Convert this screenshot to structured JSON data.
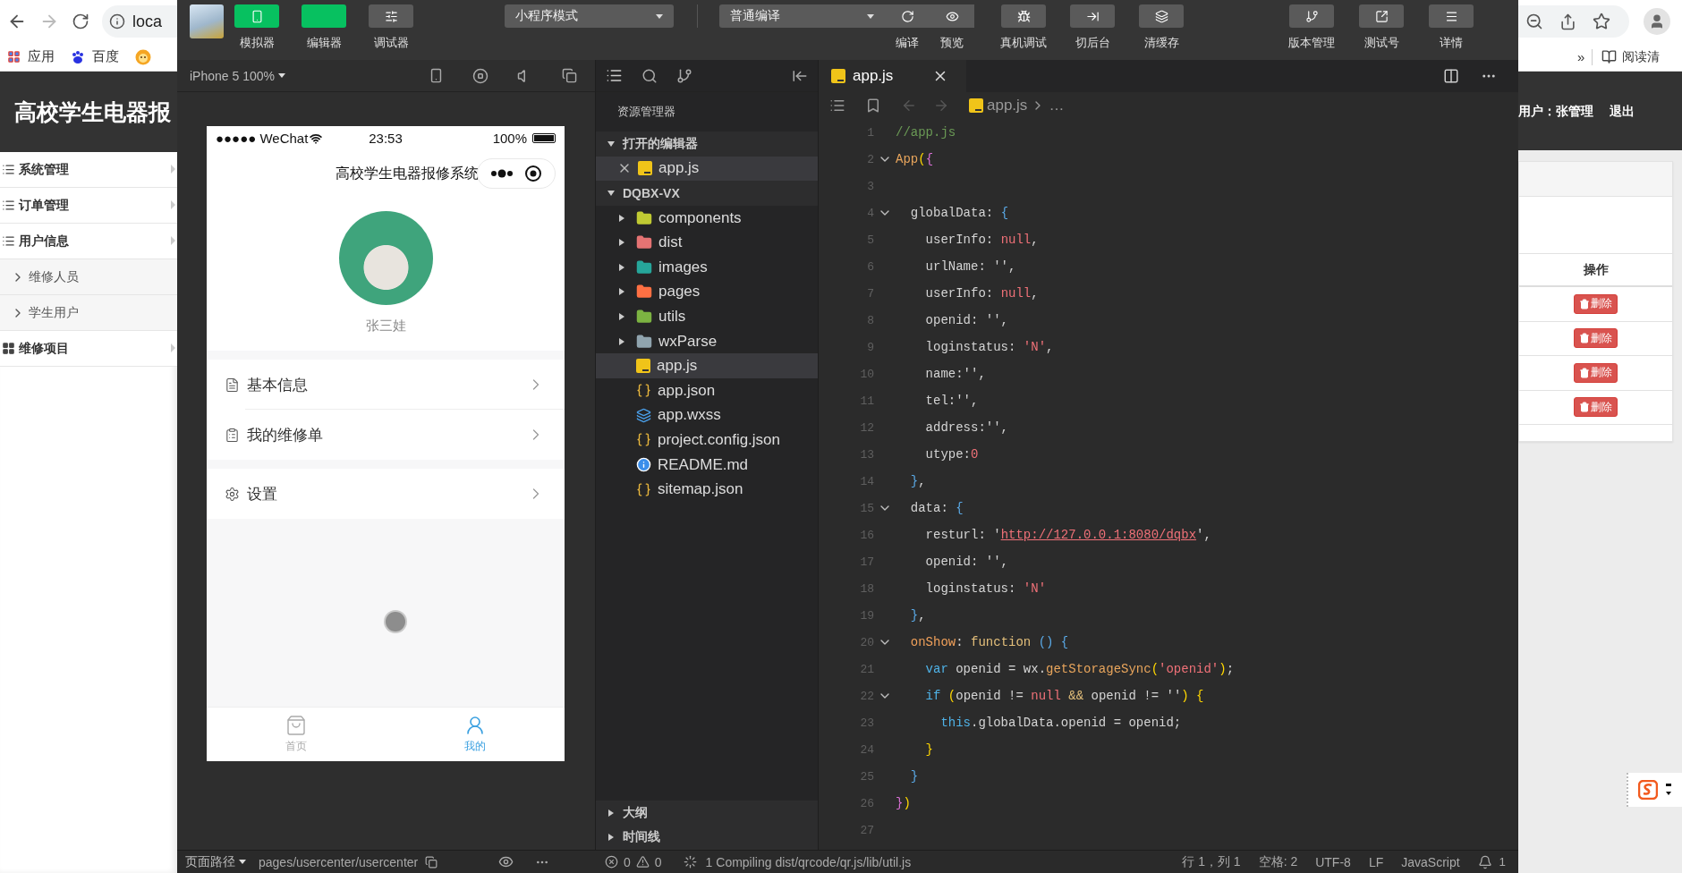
{
  "browser": {
    "address": "loca",
    "bookmarks": [
      {
        "label": "应用",
        "kind": "apps"
      },
      {
        "label": "百度",
        "kind": "baidu"
      },
      {
        "kind": "lion"
      }
    ],
    "more": "»",
    "reading_list": "阅读清"
  },
  "site": {
    "title": "高校学生电器报",
    "user": "用户：张管理",
    "logout": "退出",
    "menu": [
      {
        "label": "系统管理",
        "kind": "list"
      },
      {
        "label": "订单管理",
        "kind": "list"
      },
      {
        "label": "用户信息",
        "kind": "list",
        "children": [
          {
            "label": "维修人员"
          },
          {
            "label": "学生用户"
          }
        ]
      },
      {
        "label": "维修项目",
        "kind": "grid"
      }
    ],
    "table": {
      "header": "操作",
      "rows": [
        {
          "action": "删除"
        },
        {
          "action": "删除"
        },
        {
          "action": "删除"
        },
        {
          "action": "删除"
        }
      ]
    }
  },
  "toolbar": {
    "view_toggles": [
      {
        "label": "模拟器",
        "kind": "phone",
        "on": true
      },
      {
        "label": "编辑器",
        "kind": "code",
        "on": true
      },
      {
        "label": "调试器",
        "kind": "sliders",
        "on": false
      }
    ],
    "mode_select": "小程序模式",
    "compile_select": "普通编译",
    "compile_actions": [
      {
        "label": "编译",
        "kind": "refresh"
      },
      {
        "label": "预览",
        "kind": "eye"
      }
    ],
    "actions": [
      {
        "label": "真机调试",
        "kind": "bug"
      },
      {
        "label": "切后台",
        "kind": "exit"
      },
      {
        "label": "清缓存",
        "kind": "layers"
      }
    ],
    "right_actions": [
      {
        "label": "版本管理",
        "kind": "branch"
      },
      {
        "label": "测试号",
        "kind": "external"
      },
      {
        "label": "详情",
        "kind": "menu"
      }
    ]
  },
  "simulator": {
    "device": "iPhone 5 100%",
    "phone": {
      "carrier": "●●●●● WeChat",
      "time": "23:53",
      "battery": "100%",
      "nav_title": "高校学生电器报修系统",
      "user_name": "张三娃",
      "menu_groups": [
        [
          {
            "label": "基本信息",
            "kind": "doc"
          },
          {
            "label": "我的维修单",
            "kind": "order"
          }
        ],
        [
          {
            "label": "设置",
            "kind": "settings"
          }
        ]
      ],
      "tabs": [
        {
          "label": "首页",
          "kind": "bag",
          "selected": false
        },
        {
          "label": "我的",
          "kind": "user",
          "selected": true
        }
      ]
    }
  },
  "explorer": {
    "title": "资源管理器",
    "open_editors": {
      "label": "打开的编辑器",
      "expanded": true,
      "files": [
        {
          "name": "app.js",
          "kind": "js"
        }
      ]
    },
    "project": {
      "label": "DQBX-VX",
      "expanded": true,
      "items": [
        {
          "name": "components",
          "kind": "folder",
          "color": "#c0ca33",
          "expanded": false,
          "selected": false
        },
        {
          "name": "dist",
          "kind": "folder",
          "color": "#e57373",
          "expanded": false,
          "selected": false
        },
        {
          "name": "images",
          "kind": "folder",
          "color": "#26a69a",
          "expanded": false,
          "selected": false
        },
        {
          "name": "pages",
          "kind": "folder",
          "color": "#ff7043",
          "expanded": false,
          "selected": false
        },
        {
          "name": "utils",
          "kind": "folder",
          "color": "#7cb342",
          "expanded": false,
          "selected": false
        },
        {
          "name": "wxParse",
          "kind": "folder",
          "color": "#90a4ae",
          "expanded": false,
          "selected": false
        },
        {
          "name": "app.js",
          "kind": "js",
          "selected": true
        },
        {
          "name": "app.json",
          "kind": "json",
          "selected": false
        },
        {
          "name": "app.wxss",
          "kind": "css",
          "selected": false
        },
        {
          "name": "project.config.json",
          "kind": "json",
          "selected": false
        },
        {
          "name": "README.md",
          "kind": "info",
          "selected": false
        },
        {
          "name": "sitemap.json",
          "kind": "json",
          "selected": false
        }
      ]
    },
    "bottom_sections": [
      {
        "label": "大纲",
        "expanded": false
      },
      {
        "label": "时间线",
        "expanded": false
      }
    ]
  },
  "editor": {
    "tab": "app.js",
    "breadcrumb": [
      "app.js",
      "…"
    ],
    "lines": [
      {
        "number": "1",
        "fold": false,
        "tokens": [
          {
            "text": "//app.js",
            "kind": "comment"
          }
        ]
      },
      {
        "number": "2",
        "fold": true,
        "tokens": [
          {
            "text": "App",
            "kind": "method"
          },
          {
            "text": "(",
            "kind": "gold"
          },
          {
            "text": "{",
            "kind": "purple"
          }
        ]
      },
      {
        "number": "3",
        "fold": false
      },
      {
        "number": "4",
        "fold": true,
        "tokens": [
          {
            "text": "  globalData: ",
            "kind": "plain"
          },
          {
            "text": "{",
            "kind": "blue"
          }
        ]
      },
      {
        "number": "5",
        "fold": false,
        "tokens": [
          {
            "text": "    userInfo: ",
            "kind": "plain"
          },
          {
            "text": "null",
            "kind": "null"
          },
          {
            "text": ",",
            "kind": "plain"
          }
        ]
      },
      {
        "number": "6",
        "fold": false,
        "tokens": [
          {
            "text": "    urlName: '',",
            "kind": "plain"
          }
        ]
      },
      {
        "number": "7",
        "fold": false,
        "tokens": [
          {
            "text": "    userInfo: ",
            "kind": "plain"
          },
          {
            "text": "null",
            "kind": "null"
          },
          {
            "text": ",",
            "kind": "plain"
          }
        ]
      },
      {
        "number": "8",
        "fold": false,
        "tokens": [
          {
            "text": "    openid: '',",
            "kind": "plain"
          }
        ]
      },
      {
        "number": "9",
        "fold": false,
        "tokens": [
          {
            "text": "    loginstatus: ",
            "kind": "plain"
          },
          {
            "text": "'N'",
            "kind": "string"
          },
          {
            "text": ",",
            "kind": "plain"
          }
        ]
      },
      {
        "number": "10",
        "fold": false,
        "tokens": [
          {
            "text": "    name:'',",
            "kind": "plain"
          }
        ]
      },
      {
        "number": "11",
        "fold": false,
        "tokens": [
          {
            "text": "    tel:'',",
            "kind": "plain"
          }
        ]
      },
      {
        "number": "12",
        "fold": false,
        "tokens": [
          {
            "text": "    address:'',",
            "kind": "plain"
          }
        ]
      },
      {
        "number": "13",
        "fold": false,
        "tokens": [
          {
            "text": "    utype:",
            "kind": "plain"
          },
          {
            "text": "0",
            "kind": "number"
          }
        ]
      },
      {
        "number": "14",
        "fold": false,
        "tokens": [
          {
            "text": "  }",
            "kind": "blue"
          },
          {
            "text": ",",
            "kind": "plain"
          }
        ]
      },
      {
        "number": "15",
        "fold": true,
        "tokens": [
          {
            "text": "  data: ",
            "kind": "plain"
          },
          {
            "text": "{",
            "kind": "blue"
          }
        ]
      },
      {
        "number": "16",
        "fold": false,
        "tokens": [
          {
            "text": "    resturl: '",
            "kind": "plain"
          },
          {
            "text": "http://127.0.0.1:8080/dqbx",
            "kind": "url"
          },
          {
            "text": "',",
            "kind": "plain"
          }
        ]
      },
      {
        "number": "17",
        "fold": false,
        "tokens": [
          {
            "text": "    openid: '',",
            "kind": "plain"
          }
        ]
      },
      {
        "number": "18",
        "fold": false,
        "tokens": [
          {
            "text": "    loginstatus: ",
            "kind": "plain"
          },
          {
            "text": "'N'",
            "kind": "string"
          }
        ]
      },
      {
        "number": "19",
        "fold": false,
        "tokens": [
          {
            "text": "  }",
            "kind": "blue"
          },
          {
            "text": ",",
            "kind": "plain"
          }
        ]
      },
      {
        "number": "20",
        "fold": true,
        "tokens": [
          {
            "text": "  onShow",
            "kind": "key"
          },
          {
            "text": ": ",
            "kind": "plain"
          },
          {
            "text": "function",
            "kind": "func"
          },
          {
            "text": " ()",
            "kind": "blue"
          },
          {
            "text": " {",
            "kind": "blue"
          }
        ]
      },
      {
        "number": "21",
        "fold": false,
        "tokens": [
          {
            "text": "    var",
            "kind": "keyword"
          },
          {
            "text": " openid = wx.",
            "kind": "plain"
          },
          {
            "text": "getStorageSync",
            "kind": "method"
          },
          {
            "text": "(",
            "kind": "gold"
          },
          {
            "text": "'openid'",
            "kind": "string"
          },
          {
            "text": ")",
            "kind": "gold"
          },
          {
            "text": ";",
            "kind": "plain"
          }
        ]
      },
      {
        "number": "22",
        "fold": true,
        "tokens": [
          {
            "text": "    if",
            "kind": "keyword"
          },
          {
            "text": " (",
            "kind": "gold"
          },
          {
            "text": "openid != ",
            "kind": "plain"
          },
          {
            "text": "null",
            "kind": "null"
          },
          {
            "text": " &&",
            "kind": "func"
          },
          {
            "text": " openid != ''",
            "kind": "plain"
          },
          {
            "text": ")",
            "kind": "gold"
          },
          {
            "text": " {",
            "kind": "gold"
          }
        ]
      },
      {
        "number": "23",
        "fold": false,
        "tokens": [
          {
            "text": "      this",
            "kind": "keyword"
          },
          {
            "text": ".globalData.openid = openid;",
            "kind": "plain"
          }
        ]
      },
      {
        "number": "24",
        "fold": false,
        "tokens": [
          {
            "text": "    }",
            "kind": "gold"
          }
        ]
      },
      {
        "number": "25",
        "fold": false,
        "tokens": [
          {
            "text": "  }",
            "kind": "blue"
          }
        ]
      },
      {
        "number": "26",
        "fold": false,
        "tokens": [
          {
            "text": "}",
            "kind": "purple"
          },
          {
            "text": ")",
            "kind": "gold"
          }
        ]
      },
      {
        "number": "27",
        "fold": false
      }
    ]
  },
  "status_bar": {
    "page_path_label": "页面路径",
    "page_path": "pages/usercenter/usercenter",
    "errors": "0",
    "warnings": "0",
    "message": "1 Compiling dist/qrcode/qr.js/lib/util.js",
    "items": [
      "行 1，列 1",
      "空格: 2",
      "UTF-8",
      "LF",
      "JavaScript"
    ],
    "notifications": "1"
  }
}
